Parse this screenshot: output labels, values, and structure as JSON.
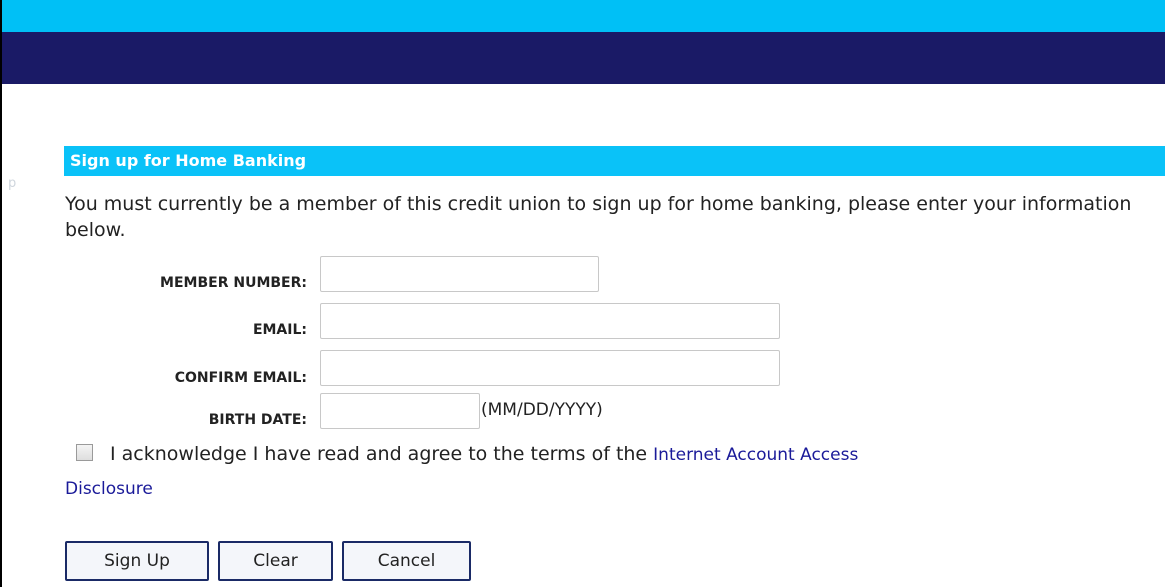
{
  "ghost_text": "p",
  "section": {
    "title": "Sign up for Home Banking",
    "intro": "You must currently be a member of this credit union to sign up for home banking, please enter your information below."
  },
  "form": {
    "member_number": {
      "label": "MEMBER NUMBER:",
      "value": ""
    },
    "email": {
      "label": "EMAIL:",
      "value": ""
    },
    "confirm_email": {
      "label": "CONFIRM EMAIL:",
      "value": ""
    },
    "birth_date": {
      "label": "BIRTH DATE:",
      "value": "",
      "hint": "(MM/DD/YYYY)"
    }
  },
  "acknowledge": {
    "checked": false,
    "text": "I acknowledge I have read and agree to the terms of the ",
    "link_part1": "Internet Account Access",
    "link_part2": "Disclosure"
  },
  "buttons": {
    "sign_up": "Sign Up",
    "clear": "Clear",
    "cancel": "Cancel"
  },
  "colors": {
    "top_bar": "#00c0f6",
    "nav_bar": "#1a1a66",
    "section_header": "#0ac2f8",
    "link": "#1a1a99",
    "button_border": "#1a2a66"
  }
}
